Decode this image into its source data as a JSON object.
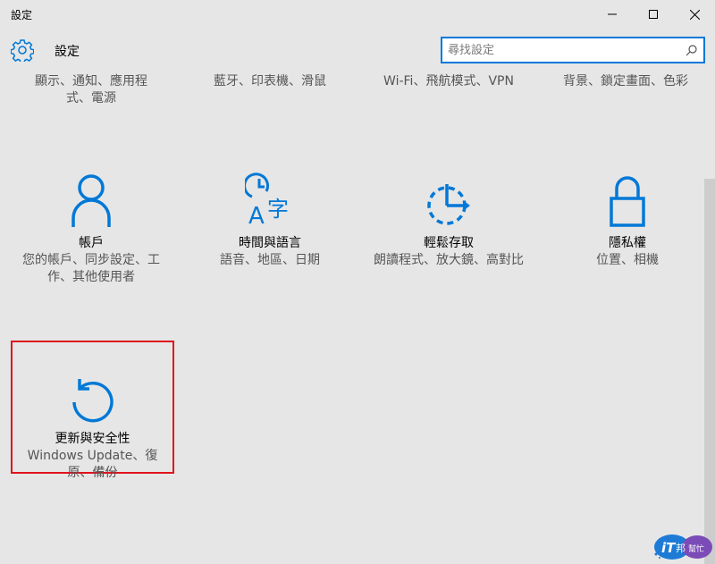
{
  "window": {
    "title": "設定",
    "minimize_icon": "minimize-icon",
    "maximize_icon": "maximize-icon",
    "close_icon": "close-icon"
  },
  "header": {
    "icon": "gear-icon",
    "title": "設定",
    "search_placeholder": "尋找設定",
    "search_icon": "search-icon"
  },
  "top_row": [
    {
      "desc": "顯示、通知、應用程式、電源"
    },
    {
      "desc": "藍牙、印表機、滑鼠"
    },
    {
      "desc": "Wi-Fi、飛航模式、VPN"
    },
    {
      "desc": "背景、鎖定畫面、色彩"
    }
  ],
  "tiles": [
    {
      "icon": "person-icon",
      "name": "帳戶",
      "desc": "您的帳戶、同步設定、工作、其他使用者"
    },
    {
      "icon": "time-language-icon",
      "name": "時間與語言",
      "desc": "語音、地區、日期"
    },
    {
      "icon": "ease-of-access-icon",
      "name": "輕鬆存取",
      "desc": "朗讀程式、放大鏡、高對比"
    },
    {
      "icon": "lock-icon",
      "name": "隱私權",
      "desc": "位置、相機"
    }
  ],
  "highlighted_tile": {
    "icon": "update-refresh-icon",
    "name": "更新與安全性",
    "desc": "Windows Update、復原、備份"
  },
  "watermark": {
    "text": "iT邦幫忙"
  },
  "colors": {
    "accent": "#0078d7",
    "highlight_border": "#e0141e",
    "background": "#e6e6e6"
  }
}
